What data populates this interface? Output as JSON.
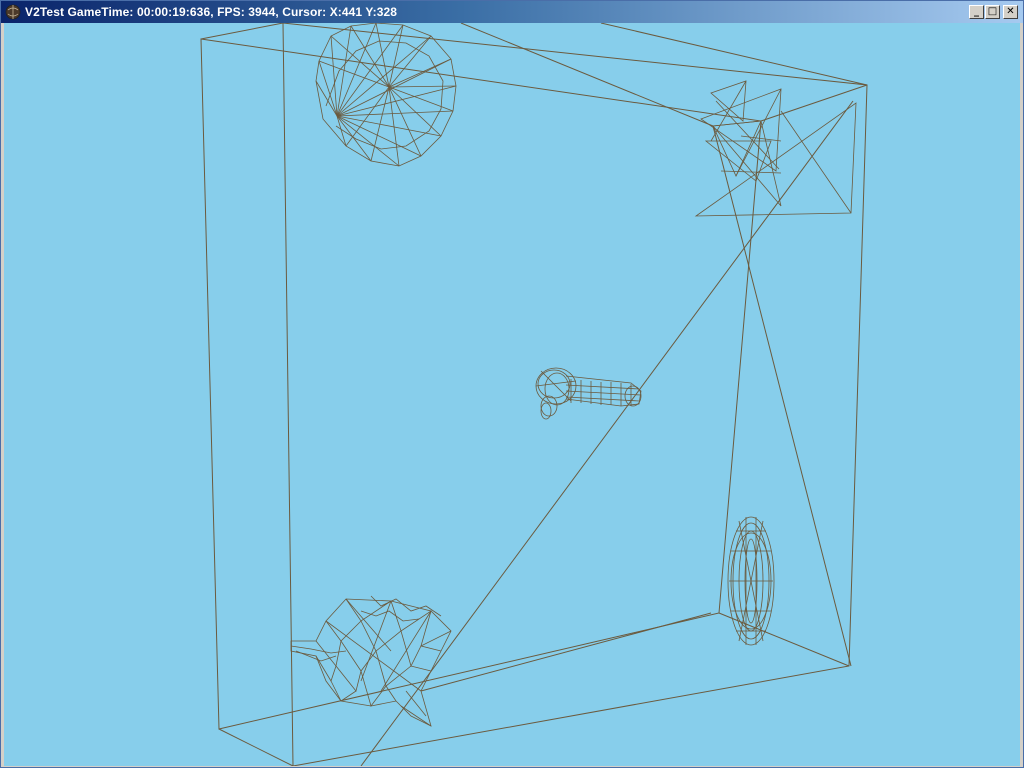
{
  "window": {
    "title": "V2Test GameTime: 00:00:19:636, FPS: 3944, Cursor: X:441 Y:328",
    "icon": "app-globe-icon",
    "controls": {
      "minimize": "_",
      "maximize": "□",
      "close": "✕"
    }
  },
  "scene": {
    "background_color": "#87ceeb",
    "wire_color": "#6b5a3e",
    "objects": [
      "frustum-frame",
      "spiral-fan-mesh",
      "nested-triangle-meshes",
      "handle-mesh",
      "torus-mesh",
      "head-mesh"
    ]
  }
}
